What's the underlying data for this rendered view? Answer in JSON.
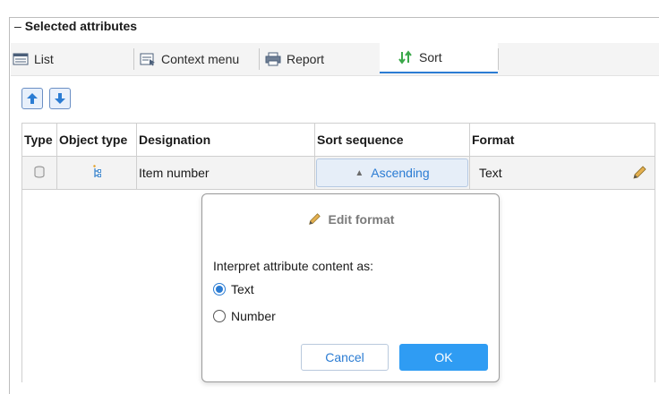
{
  "group": {
    "title": "Selected attributes",
    "dash": "–"
  },
  "tabs": [
    {
      "label": "List",
      "icon": "list-icon"
    },
    {
      "label": "Context menu",
      "icon": "context-menu-icon"
    },
    {
      "label": "Report",
      "icon": "report-icon"
    },
    {
      "label": "Sort",
      "icon": "sort-icon",
      "active": true
    }
  ],
  "toolbar": {
    "move_up_icon": "arrow-up-icon",
    "move_down_icon": "arrow-down-icon"
  },
  "table": {
    "headers": [
      "Type",
      "Object type",
      "Designation",
      "Sort sequence",
      "Format"
    ],
    "rows": [
      {
        "type_icon": "cylinder-icon",
        "object_type_icon": "item-structure-icon",
        "designation": "Item number",
        "sort_sequence": "Ascending",
        "sort_arrow": "▲",
        "format": "Text"
      }
    ]
  },
  "popup": {
    "title": "Edit format",
    "prompt": "Interpret attribute content as:",
    "options": [
      {
        "label": "Text",
        "checked": true
      },
      {
        "label": "Number",
        "checked": false
      }
    ],
    "cancel_label": "Cancel",
    "ok_label": "OK"
  },
  "colors": {
    "accent": "#2b7cd3",
    "ok_button": "#2f9cf3"
  }
}
